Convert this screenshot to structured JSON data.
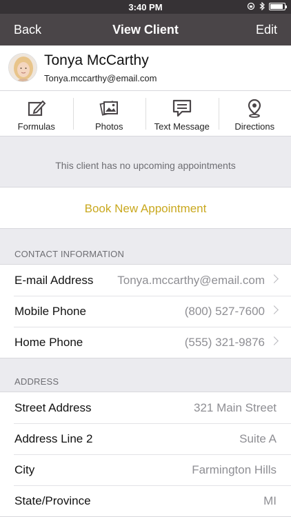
{
  "status_bar": {
    "time": "3:40 PM",
    "battery_level": 0.9
  },
  "nav": {
    "back": "Back",
    "title": "View Client",
    "edit": "Edit"
  },
  "client": {
    "name": "Tonya McCarthy",
    "email": "Tonya.mccarthy@email.com"
  },
  "actions": [
    {
      "label": "Formulas",
      "icon": "edit-icon"
    },
    {
      "label": "Photos",
      "icon": "photos-icon"
    },
    {
      "label": "Text Message",
      "icon": "message-icon"
    },
    {
      "label": "Directions",
      "icon": "location-pin-icon"
    }
  ],
  "appointments": {
    "empty_text": "This client has no upcoming appointments",
    "book_label": "Book New Appointment"
  },
  "contact": {
    "header": "CONTACT INFORMATION",
    "rows": [
      {
        "label": "E-mail Address",
        "value": "Tonya.mccarthy@email.com"
      },
      {
        "label": "Mobile Phone",
        "value": "(800) 527-7600"
      },
      {
        "label": "Home Phone",
        "value": "(555) 321-9876"
      }
    ]
  },
  "address": {
    "header": "ADDRESS",
    "rows": [
      {
        "label": "Street Address",
        "value": "321 Main Street"
      },
      {
        "label": "Address Line 2",
        "value": "Suite A"
      },
      {
        "label": "City",
        "value": "Farmington Hills"
      },
      {
        "label": "State/Province",
        "value": "MI"
      }
    ]
  },
  "colors": {
    "nav": "#4a4548",
    "accent": "#c9a81e",
    "background": "#ebebef"
  }
}
